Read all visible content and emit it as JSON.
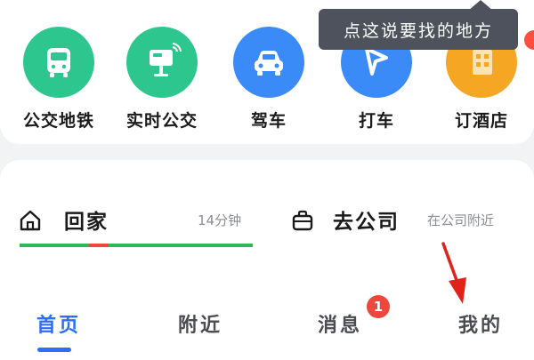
{
  "services": [
    {
      "label": "公交地铁",
      "icon": "bus-icon",
      "color": "#2ec68f"
    },
    {
      "label": "实时公交",
      "icon": "realtime-bus-stop-icon",
      "color": "#2ec68f"
    },
    {
      "label": "驾车",
      "icon": "car-icon",
      "color": "#3a8bf7"
    },
    {
      "label": "打车",
      "icon": "taxi-hail-icon",
      "color": "#3a8bf7"
    },
    {
      "label": "订酒店",
      "icon": "hotel-icon",
      "color": "#f5a623"
    }
  ],
  "tooltip": {
    "text": "点这说要找的地方"
  },
  "commute": {
    "home": {
      "title": "回家",
      "detail": "14分钟",
      "icon": "home-icon"
    },
    "company": {
      "title": "去公司",
      "detail": "在公司附近",
      "icon": "briefcase-icon"
    }
  },
  "tabs": [
    {
      "label": "首页",
      "active": true
    },
    {
      "label": "附近",
      "active": false
    },
    {
      "label": "消息",
      "active": false,
      "badge": "1"
    },
    {
      "label": "我的",
      "active": false
    }
  ],
  "colors": {
    "accent": "#2b6ef7",
    "traffic_ok": "#2fb85b",
    "traffic_jam": "#f0473c"
  }
}
